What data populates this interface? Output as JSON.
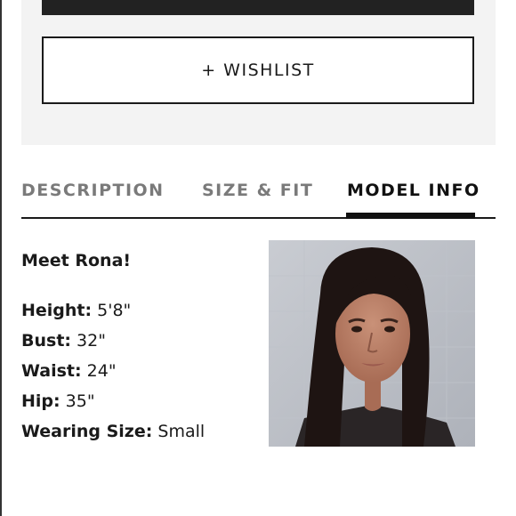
{
  "actions": {
    "wishlist_label": "+ WISHLIST"
  },
  "tabs": [
    {
      "label": "DESCRIPTION",
      "active": false
    },
    {
      "label": "SIZE & FIT",
      "active": false
    },
    {
      "label": "MODEL INFO",
      "active": true
    }
  ],
  "model": {
    "intro": "Meet Rona!",
    "rows": [
      {
        "label": "Height:",
        "value": "5'8\""
      },
      {
        "label": "Bust:",
        "value": "32\""
      },
      {
        "label": "Waist:",
        "value": "24\""
      },
      {
        "label": "Hip:",
        "value": "35\""
      },
      {
        "label": "Wearing Size:",
        "value": "Small"
      }
    ]
  },
  "colors": {
    "accent": "#111111",
    "inactive_tab": "#7a7a7a",
    "panel_bg": "#f3f3f3"
  }
}
